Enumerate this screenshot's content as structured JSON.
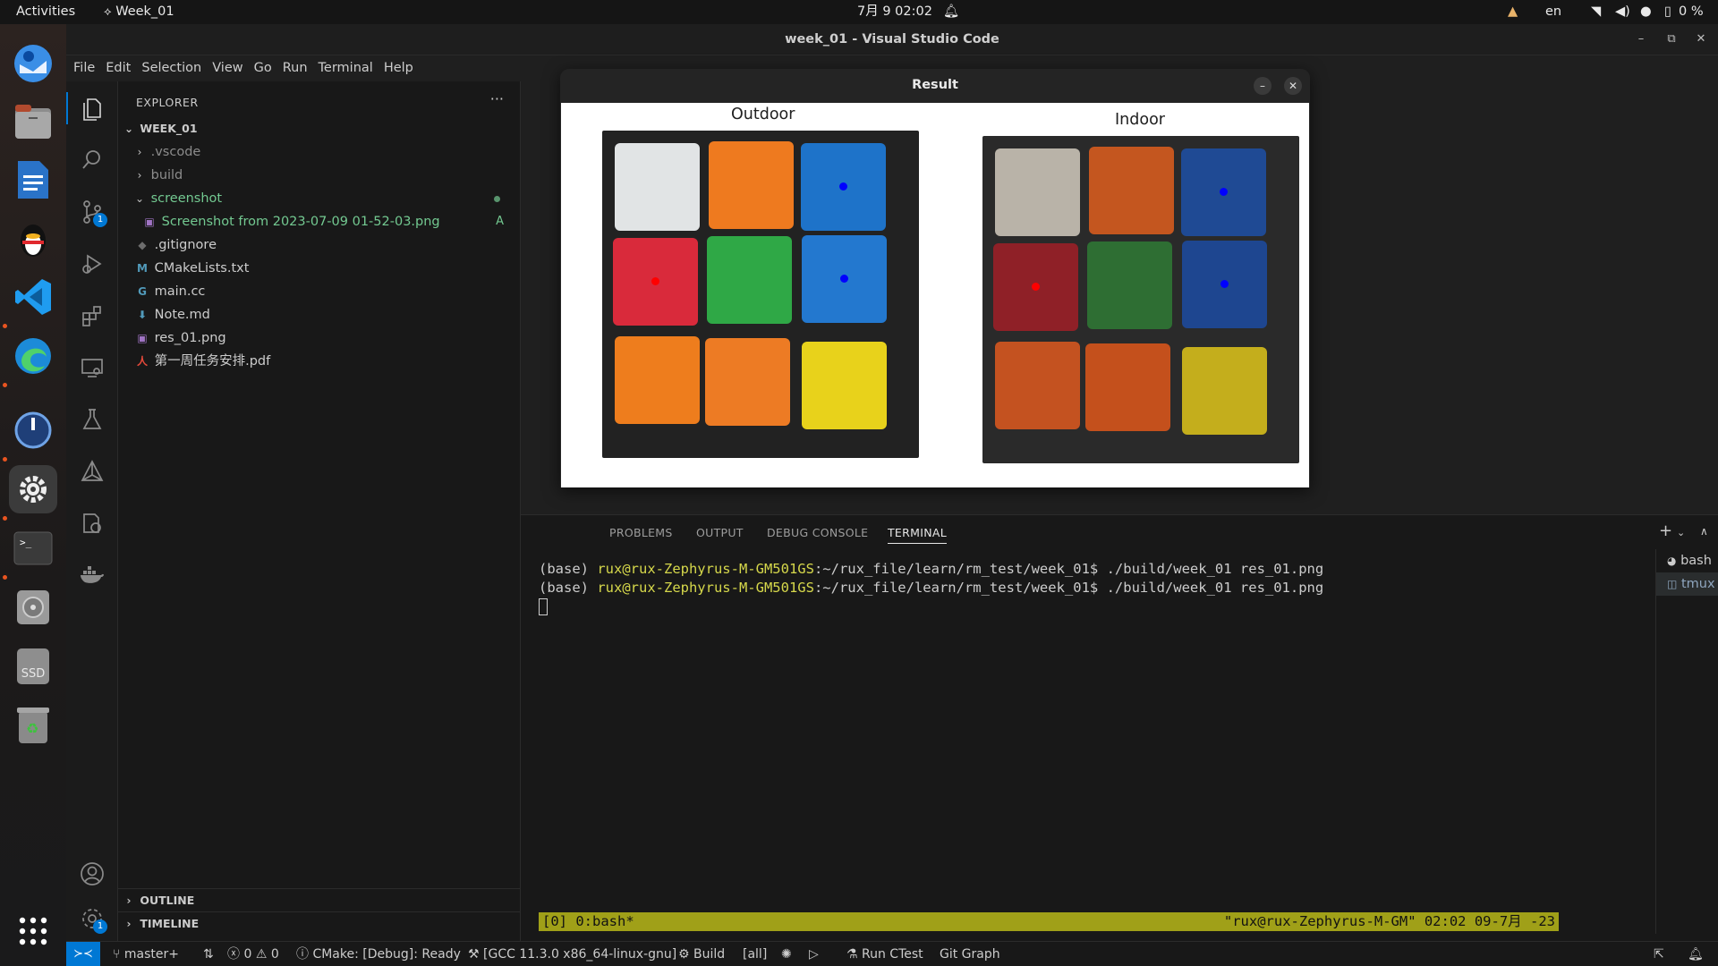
{
  "topbar": {
    "activities": "Activities",
    "app": "Week_01",
    "datetime": "7月 9  02:02",
    "lang": "en",
    "battery": "0 %"
  },
  "window": {
    "title": "week_01 - Visual Studio Code"
  },
  "menu": [
    "File",
    "Edit",
    "Selection",
    "View",
    "Go",
    "Run",
    "Terminal",
    "Help"
  ],
  "activitybar": {
    "scm_badge": "1",
    "settings_badge": "1"
  },
  "sidebar": {
    "header": "EXPLORER",
    "more": "···",
    "root": "WEEK_01",
    "items": [
      {
        "label": ".vscode"
      },
      {
        "label": "build"
      },
      {
        "label": "screenshot"
      },
      {
        "label": "Screenshot from 2023-07-09 01-52-03.png",
        "git": "A"
      },
      {
        "label": ".gitignore"
      },
      {
        "label": "CMakeLists.txt"
      },
      {
        "label": "main.cc"
      },
      {
        "label": "Note.md"
      },
      {
        "label": "res_01.png"
      },
      {
        "label": "第一周任务安排.pdf"
      }
    ],
    "outline": "OUTLINE",
    "timeline": "TIMELINE"
  },
  "result": {
    "title": "Result",
    "labels": [
      "Outdoor",
      "Indoor"
    ],
    "outdoor_colors": [
      "#e1e4e5",
      "#ee7a1f",
      "#1e73c9",
      "#d92a3b",
      "#2fa846",
      "#2378cf",
      "#ee7d1d",
      "#ed7b24",
      "#e8d21b"
    ],
    "indoor_colors": [
      "#b9b3a8",
      "#c4561f",
      "#1f4a94",
      "#8f2027",
      "#2e6e33",
      "#1e4690",
      "#c45220",
      "#c4501c",
      "#c4ae1c"
    ],
    "marker_colors": {
      "red": "#ff0000",
      "blue": "#0000ff"
    }
  },
  "panel": {
    "tabs": [
      "PROBLEMS",
      "OUTPUT",
      "DEBUG CONSOLE",
      "TERMINAL"
    ],
    "terminal": {
      "prefix": "(base) ",
      "user_host": "rux@rux-Zephyrus-M-GM501GS",
      "path": ":~/rux_file/learn/rm_test/week_01$ ",
      "command": "./build/week_01 res_01.png",
      "tmux_left": "[0] 0:bash*",
      "tmux_right": "\"rux@rux-Zephyrus-M-GM\" 02:02 09-7月 -23"
    },
    "terminals": [
      "bash",
      "tmux"
    ]
  },
  "status": {
    "branch": "master+",
    "errors": "0",
    "warnings": "0",
    "cmake": "CMake: [Debug]: Ready",
    "kit": "[GCC 11.3.0 x86_64-linux-gnu]",
    "build": "Build",
    "target": "[all]",
    "ctest": "Run CTest",
    "gitgraph": "Git Graph"
  },
  "dock": {
    "ssd_label": "SSD"
  }
}
